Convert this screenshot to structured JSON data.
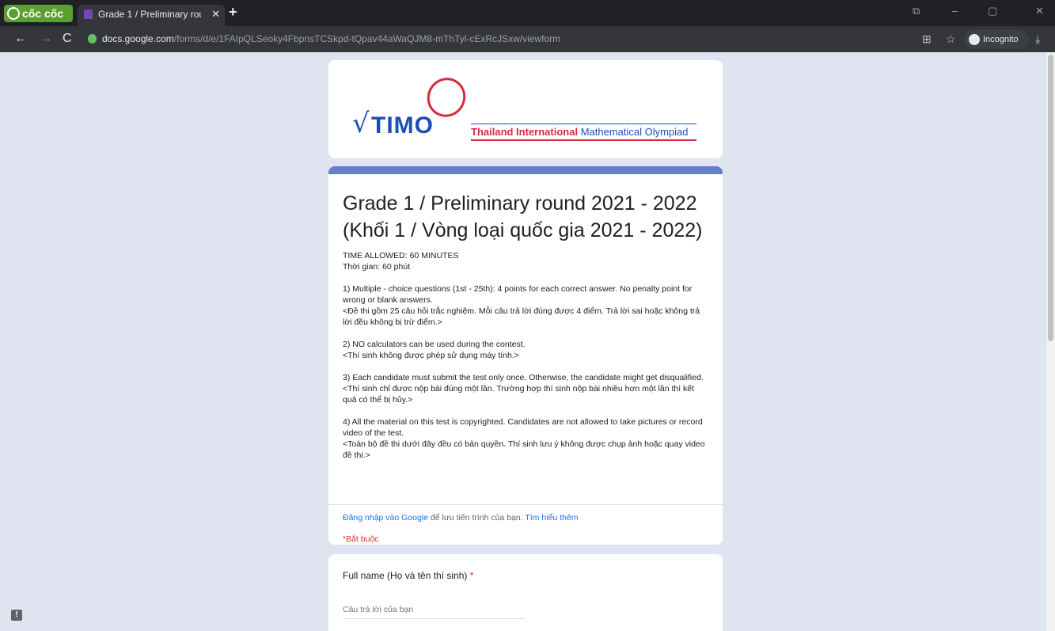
{
  "browser": {
    "brand": "cốc cốc",
    "tab_title": "Grade 1 / Preliminary round 2021 - 2022",
    "tab_close": "✕",
    "new_tab": "+",
    "url_host": "docs.google.com",
    "url_path": "/forms/d/e/1FAIpQLSeoky4FbpnsTCSkpd-tQpav44aWaQJM8-mThTyl-cExRcJSxw/viewform",
    "incognito_label": "Incognito",
    "nav_back": "←",
    "nav_forward": "→",
    "nav_reload": "C",
    "minimize": "–",
    "restore": "▢",
    "close": "✕"
  },
  "logo": {
    "sqrt": "√",
    "timo": "TIMO",
    "text_bold": "Thailand International",
    "text_rest": " Mathematical  Olympiad"
  },
  "form": {
    "title": "Grade 1 / Preliminary round 2021 - 2022 (Khối 1 / Vòng loại quốc gia 2021 - 2022)",
    "description": [
      "TIME ALLOWED: 60 MINUTES\nThời gian: 60 phút",
      "1) Multiple - choice questions (1st - 25th): 4 points for each correct answer. No penalty point for wrong or blank answers.\n<Đề thi gồm 25 câu hỏi trắc nghiệm. Mỗi câu trả lời đúng được 4 điểm. Trả lời sai hoặc không trả lời đều không bị trừ điểm.>",
      "2) NO calculators can be used during the contest.\n<Thí sinh không được phép sử dụng máy tính.>",
      "3) Each candidate must submit the test only once. Otherwise, the candidate might get disqualified.\n<Thí sinh chỉ được nộp bài đúng một lần. Trường hợp thí sinh nộp bài nhiều hơn một lần thì kết quả có thể bị hủy.>",
      "4) All the material on this test is copyrighted. Candidates are not allowed to take pictures or record video of the test.\n<Toàn bộ đề thi dưới đây đều có bản quyền. Thí sinh lưu ý không được chụp ảnh hoặc quay video đề thi.>"
    ],
    "signin_link": "Đăng nhập vào Google",
    "signin_text": " để lưu tiến trình của bạn. ",
    "learn_more": "Tìm hiểu thêm",
    "required_note": "*Bắt buộc"
  },
  "question": {
    "label": "Full name (Họ và tên thí sinh)",
    "star": "*",
    "placeholder": "Câu trả lời của bạn"
  },
  "feedback_icon": "!"
}
